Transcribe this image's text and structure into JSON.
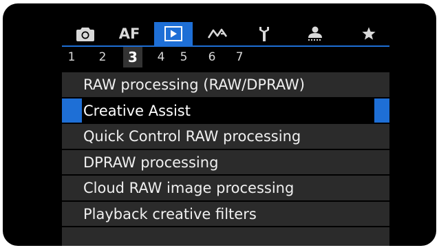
{
  "tabs": [
    {
      "name": "shooting",
      "icon": "camera-icon",
      "active": false
    },
    {
      "name": "af",
      "label": "AF",
      "icon": "af-text",
      "active": false
    },
    {
      "name": "playback",
      "icon": "play-icon",
      "active": true
    },
    {
      "name": "wireless",
      "icon": "wireless-icon",
      "active": false
    },
    {
      "name": "setup",
      "icon": "wrench-icon",
      "active": false
    },
    {
      "name": "custom",
      "icon": "custom-functions-icon",
      "active": false
    },
    {
      "name": "mymenu",
      "icon": "star-icon",
      "active": false
    }
  ],
  "pages": [
    "1",
    "2",
    "3",
    "4",
    "5",
    "6",
    "7"
  ],
  "active_page": "3",
  "menu": {
    "items": [
      {
        "label": "RAW processing (RAW/DPRAW)",
        "selected": false
      },
      {
        "label": "Creative Assist",
        "selected": true
      },
      {
        "label": "Quick Control RAW processing",
        "selected": false
      },
      {
        "label": "DPRAW processing",
        "selected": false
      },
      {
        "label": "Cloud RAW image processing",
        "selected": false
      },
      {
        "label": "Playback creative filters",
        "selected": false
      },
      {
        "label": "",
        "selected": false
      }
    ]
  },
  "colors": {
    "accent": "#1e6fd6",
    "item_bg": "#2b2b2b",
    "screen_bg": "#000000"
  }
}
